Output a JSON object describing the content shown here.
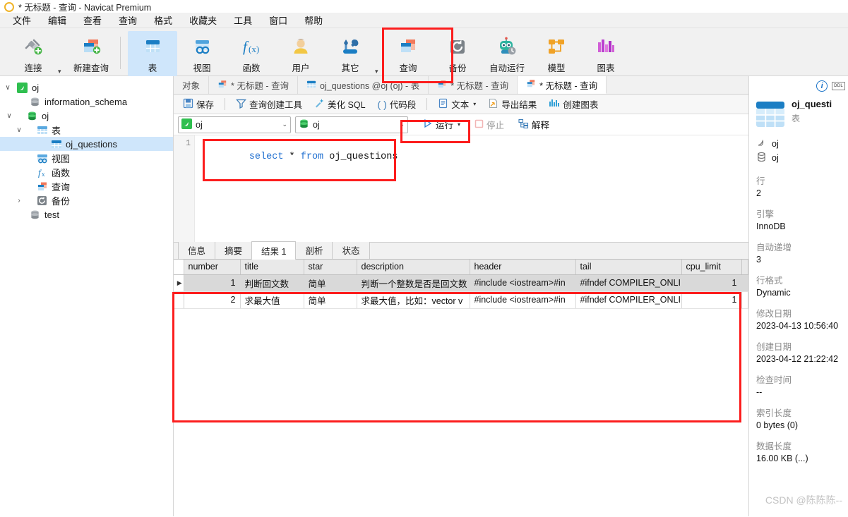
{
  "window": {
    "title": "* 无标题 - 查询 - Navicat Premium",
    "logo_icon": "navicat-logo-icon"
  },
  "menubar": {
    "items": [
      {
        "label": "文件"
      },
      {
        "label": "编辑"
      },
      {
        "label": "查看"
      },
      {
        "label": "查询"
      },
      {
        "label": "格式"
      },
      {
        "label": "收藏夹"
      },
      {
        "label": "工具"
      },
      {
        "label": "窗口"
      },
      {
        "label": "帮助"
      }
    ]
  },
  "toolbar": {
    "items": [
      {
        "label": "连接",
        "icon": "connection-icon",
        "has_caret": true,
        "active": false
      },
      {
        "label": "新建查询",
        "icon": "new-query-icon",
        "has_caret": false,
        "active": false
      },
      {
        "label": "表",
        "icon": "table-icon",
        "has_caret": false,
        "active": true
      },
      {
        "label": "视图",
        "icon": "view-icon",
        "has_caret": false,
        "active": false
      },
      {
        "label": "函数",
        "icon": "function-icon",
        "has_caret": false,
        "active": false
      },
      {
        "label": "用户",
        "icon": "user-icon",
        "has_caret": false,
        "active": false
      },
      {
        "label": "其它",
        "icon": "other-tools-icon",
        "has_caret": true,
        "active": false
      },
      {
        "label": "查询",
        "icon": "query-icon",
        "has_caret": false,
        "active": false
      },
      {
        "label": "备份",
        "icon": "backup-icon",
        "has_caret": false,
        "active": false
      },
      {
        "label": "自动运行",
        "icon": "automation-icon",
        "has_caret": false,
        "active": false
      },
      {
        "label": "模型",
        "icon": "model-icon",
        "has_caret": false,
        "active": false
      },
      {
        "label": "图表",
        "icon": "chart-icon",
        "has_caret": false,
        "active": false
      }
    ]
  },
  "tree": {
    "nodes": [
      {
        "label": "oj",
        "icon": "mysql-connection-icon",
        "indent": 0,
        "twisty": "∨",
        "selected": false
      },
      {
        "label": "information_schema",
        "icon": "database-gray-icon",
        "indent": 1,
        "twisty": "",
        "selected": false
      },
      {
        "label": "oj",
        "icon": "database-green-icon",
        "indent": 1,
        "twisty": "∨",
        "selected": false
      },
      {
        "label": "表",
        "icon": "table-folder-icon",
        "indent": 2,
        "twisty": "∨",
        "selected": false
      },
      {
        "label": "oj_questions",
        "icon": "table-icon",
        "indent": 3,
        "twisty": "",
        "selected": true
      },
      {
        "label": "视图",
        "icon": "view-icon",
        "indent": 2,
        "twisty": "",
        "selected": false
      },
      {
        "label": "函数",
        "icon": "function-icon",
        "indent": 2,
        "twisty": "",
        "selected": false
      },
      {
        "label": "查询",
        "icon": "query-icon",
        "indent": 2,
        "twisty": "",
        "selected": false
      },
      {
        "label": "备份",
        "icon": "backup-icon",
        "indent": 2,
        "twisty": "›",
        "selected": false
      },
      {
        "label": "test",
        "icon": "database-gray-icon",
        "indent": 1,
        "twisty": "",
        "selected": false
      }
    ]
  },
  "tabs": [
    {
      "label": "对象",
      "icon": "",
      "active": false
    },
    {
      "label": "* 无标题 - 查询",
      "icon": "query-icon",
      "active": false
    },
    {
      "label": "oj_questions @oj (oj) - 表",
      "icon": "table-icon",
      "active": false
    },
    {
      "label": "* 无标题 - 查询",
      "icon": "query-icon",
      "active": false
    },
    {
      "label": "* 无标题 - 查询",
      "icon": "query-icon",
      "active": true
    }
  ],
  "query_toolbar": {
    "save": "保存",
    "query_builder": "查询创建工具",
    "beautify_sql": "美化 SQL",
    "snippet": "代码段",
    "snippet_prefix": "( )",
    "text": "文本",
    "export_result": "导出结果",
    "create_chart": "创建图表"
  },
  "connbar": {
    "connection_value": "oj",
    "database_value": "oj",
    "run_label": "运行",
    "stop_label": "停止",
    "explain_label": "解释"
  },
  "editor": {
    "line_number": "1",
    "sql_tokens": [
      {
        "t": "select",
        "k": "kw"
      },
      {
        "t": " ",
        "k": "op"
      },
      {
        "t": "*",
        "k": "op"
      },
      {
        "t": " ",
        "k": "op"
      },
      {
        "t": "from",
        "k": "kw"
      },
      {
        "t": " ",
        "k": "op"
      },
      {
        "t": "oj_questions",
        "k": "id"
      }
    ],
    "sql_text": "select * from oj_questions"
  },
  "results": {
    "tabs": [
      {
        "label": "信息",
        "active": false
      },
      {
        "label": "摘要",
        "active": false
      },
      {
        "label": "结果 1",
        "active": true
      },
      {
        "label": "剖析",
        "active": false
      },
      {
        "label": "状态",
        "active": false
      }
    ],
    "columns": [
      "number",
      "title",
      "star",
      "description",
      "header",
      "tail",
      "cpu_limit"
    ],
    "rows": [
      {
        "selected": true,
        "marker": "▶",
        "cells": [
          "1",
          "判断回文数",
          "简单",
          "判断一个整数是否是回文数",
          "#include <iostream>#in",
          "#ifndef COMPILER_ONLI",
          "1"
        ]
      },
      {
        "selected": false,
        "marker": "",
        "cells": [
          "2",
          "求最大值",
          "简单",
          "求最大值，比如：vector v",
          "#include <iostream>#in",
          "#ifndef COMPILER_ONLI",
          "1"
        ]
      }
    ]
  },
  "info_panel": {
    "info_icon": "info-circle-icon",
    "ddl_label": "DDL",
    "table_name": "oj_questi",
    "object_type": "表",
    "connection": "oj",
    "database": "oj",
    "properties": [
      {
        "key": "行",
        "value": "2"
      },
      {
        "key": "引擎",
        "value": "InnoDB"
      },
      {
        "key": "自动递增",
        "value": "3"
      },
      {
        "key": "行格式",
        "value": "Dynamic"
      },
      {
        "key": "修改日期",
        "value": "2023-04-13 10:56:40"
      },
      {
        "key": "创建日期",
        "value": "2023-04-12 21:22:42"
      },
      {
        "key": "检查时间",
        "value": "--"
      },
      {
        "key": "索引长度",
        "value": "0 bytes (0)"
      },
      {
        "key": "数据长度",
        "value": "16.00 KB (...)"
      }
    ]
  },
  "watermark": {
    "text": "CSDN @陈陈陈--"
  },
  "colors": {
    "annotation_red": "#fc1d1d",
    "selection_blue": "#cfe6fb",
    "keyword_blue": "#1f6fd0"
  }
}
